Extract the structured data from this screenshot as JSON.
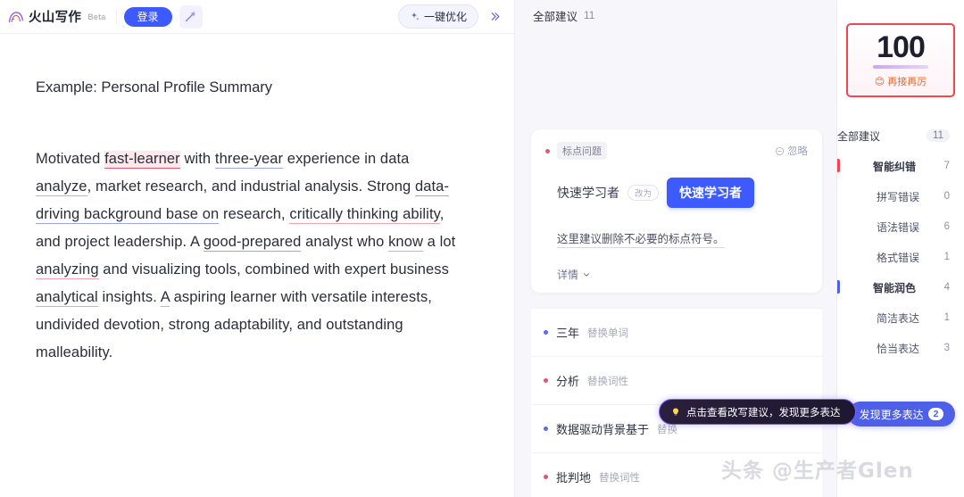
{
  "header": {
    "brand_name": "火山写作",
    "beta_tag": "Beta",
    "login_label": "登录",
    "magic_icon": "magic-wand-icon",
    "optimize_label": "一键优化",
    "optimize_icon": "sparkle-icon",
    "collapse_icon": "chevron-double-right-icon"
  },
  "document": {
    "title": "Example: Personal Profile Summary",
    "paragraph_segments": [
      {
        "text": "Motivated ",
        "mark": "none"
      },
      {
        "text": "fast-learner",
        "mark": "error"
      },
      {
        "text": " with ",
        "mark": "none"
      },
      {
        "text": "three-year",
        "mark": "blue"
      },
      {
        "text": " experience in data ",
        "mark": "none"
      },
      {
        "text": "analyze",
        "mark": "red"
      },
      {
        "text": ", market research, and industrial analysis. Strong ",
        "mark": "none"
      },
      {
        "text": "data-driving background base on",
        "mark": "blue"
      },
      {
        "text": " research, ",
        "mark": "none"
      },
      {
        "text": "critically thinking ability",
        "mark": "red"
      },
      {
        "text": ", and project leadership. A ",
        "mark": "none"
      },
      {
        "text": "good-prepared",
        "mark": "blue"
      },
      {
        "text": " analyst who ",
        "mark": "none"
      },
      {
        "text": "know",
        "mark": "red"
      },
      {
        "text": " a lot ",
        "mark": "none"
      },
      {
        "text": "analyzing",
        "mark": "red"
      },
      {
        "text": " and visualizing tools, combined with expert business ",
        "mark": "none"
      },
      {
        "text": "analytical",
        "mark": "red"
      },
      {
        "text": " insights. ",
        "mark": "none"
      },
      {
        "text": "A",
        "mark": "red"
      },
      {
        "text": " aspiring learner with versatile interests, undivided devotion, strong adaptability, and outstanding malleability.",
        "mark": "none"
      }
    ]
  },
  "suggestions": {
    "header_label": "全部建议",
    "header_count": "11",
    "card": {
      "category": "标点问题",
      "ignore_label": "忽略",
      "ignore_icon": "circle-minus-icon",
      "original": "快速学习者",
      "arrow_label": "改为",
      "replacement": "快速学习者",
      "description": "这里建议删除不必要的标点符号。",
      "detail_label": "详情",
      "detail_icon": "chevron-down-icon"
    },
    "items": [
      {
        "word": "三年",
        "type": "替换单词",
        "dot": "#5a6bea"
      },
      {
        "word": "分析",
        "type": "替换词性",
        "dot": "#e8536e"
      },
      {
        "word": "数据驱动背景基于",
        "type": "替换",
        "dot": "#5a6bea"
      },
      {
        "word": "批判地",
        "type": "替换词性",
        "dot": "#e8536e"
      }
    ]
  },
  "tooltip": {
    "icon": "lightbulb-icon",
    "text": "点击查看改写建议，发现更多表达"
  },
  "sidebar": {
    "score": "100",
    "score_label": "再接再厉",
    "score_emoji": "😊",
    "nav": [
      {
        "label": "全部建议",
        "count": "11",
        "level": "top",
        "bar": null
      },
      {
        "label": "智能纠错",
        "count": "7",
        "level": "head",
        "bar": "#f4444f"
      },
      {
        "label": "拼写错误",
        "count": "0",
        "level": "sub",
        "bar": null
      },
      {
        "label": "语法错误",
        "count": "6",
        "level": "sub",
        "bar": null
      },
      {
        "label": "格式错误",
        "count": "1",
        "level": "sub",
        "bar": null
      },
      {
        "label": "智能润色",
        "count": "4",
        "level": "head",
        "bar": "#4f60e8"
      },
      {
        "label": "简洁表达",
        "count": "1",
        "level": "sub",
        "bar": null
      },
      {
        "label": "恰当表达",
        "count": "3",
        "level": "sub",
        "bar": null
      }
    ],
    "discover_label": "发现更多表达",
    "discover_count": "2"
  },
  "watermark": {
    "text": "头条 @生产者Glen"
  },
  "colors": {
    "brand_blue": "#3d5afe",
    "error_red": "#e8536e",
    "polish_blue": "#4f60e8",
    "score_border": "#f4444f"
  }
}
